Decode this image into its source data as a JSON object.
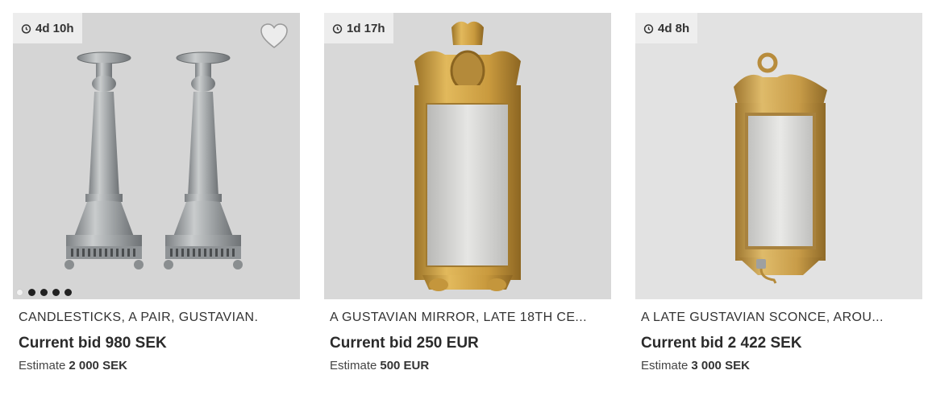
{
  "lots": [
    {
      "time_left": "4d 10h",
      "title": "CANDLESTICKS, A PAIR, GUSTAVIAN.",
      "current_bid": "Current bid 980 SEK",
      "estimate_label": "Estimate",
      "estimate_value": "2 000 SEK",
      "image_subject": "pewter candlesticks pair",
      "carousel": {
        "count": 5,
        "active_index": 0
      },
      "favorite_icon": "heart-icon"
    },
    {
      "time_left": "1d 17h",
      "title": "A GUSTAVIAN MIRROR, LATE 18TH CE...",
      "current_bid": "Current bid 250 EUR",
      "estimate_label": "Estimate",
      "estimate_value": "500 EUR",
      "image_subject": "gilded mirror"
    },
    {
      "time_left": "4d 8h",
      "title": "A LATE GUSTAVIAN SCONCE, AROU...",
      "current_bid": "Current bid 2 422 SEK",
      "estimate_label": "Estimate",
      "estimate_value": "3 000 SEK",
      "image_subject": "gilded mirror sconce"
    }
  ],
  "icons": {
    "timer": "clock-icon"
  },
  "colors": {
    "photo_background": "#d6d6d6",
    "gold": "#c99a3e",
    "pewter": "#a4a8ab"
  }
}
